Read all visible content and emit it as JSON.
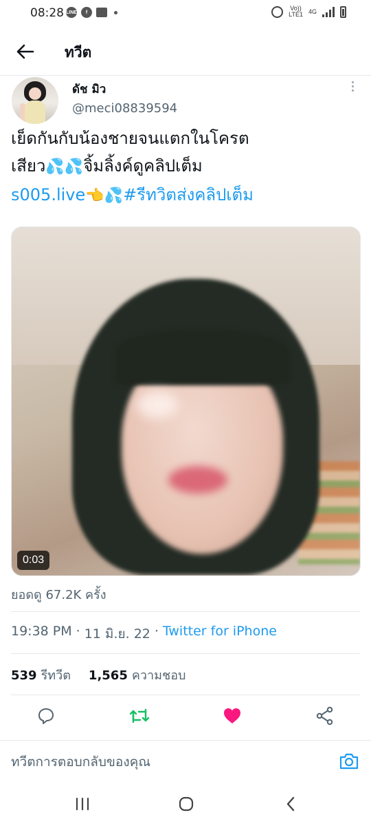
{
  "status_bar": {
    "time": "08:28",
    "left_icons": [
      "line-icon",
      "facebook-icon",
      "gallery-icon",
      "notification-dot"
    ],
    "line_badge": "LINE",
    "network_top": "Vo))",
    "network_bottom": "LTE1",
    "network_gen": "4G",
    "right_icons": [
      "alarm-icon",
      "signal-icon",
      "battery-icon"
    ]
  },
  "header": {
    "title": "ทวีต",
    "back_icon": "arrow-left-icon"
  },
  "tweet": {
    "author": {
      "display_name": "ดัช มิว",
      "handle": "@meci08839594"
    },
    "text": {
      "line1": "เย็ดกันกับน้องชายจนแตกในโครต",
      "line2_text": "เสียว",
      "line2_emoji": "💦💦",
      "line2_tail": "จิ้มลิ้งค์ดูคลิปเต็ม",
      "link": "s005.live",
      "pointing_emoji": "👈",
      "drops_emoji": "💦",
      "hashtag": "#รีทวิตส่งคลิปเต็ม"
    },
    "media": {
      "duration": "0:03"
    },
    "views": "ยอดดู 67.2K ครั้ง",
    "time": "19:38 PM",
    "separator": "·",
    "date": "11 มิ.ย. 22",
    "source": "Twitter for iPhone",
    "retweets_count": "539",
    "retweets_label": "รีทวีต",
    "likes_count": "1,565",
    "likes_label": "ความชอบ"
  },
  "actions": {
    "icons": [
      "reply-icon",
      "retweet-icon",
      "like-icon",
      "share-icon"
    ],
    "colors": {
      "retweet": "#17bf63",
      "like": "#f91880",
      "default": "#536471"
    }
  },
  "reply": {
    "placeholder": "ทวีตการตอบกลับของคุณ",
    "camera_icon": "camera-icon"
  },
  "nav_bar": {
    "icons": [
      "recent-apps-icon",
      "home-icon",
      "back-icon"
    ]
  },
  "colors": {
    "accent": "#1d9bf0",
    "secondary_text": "#536471",
    "primary_text": "#0f1419"
  }
}
